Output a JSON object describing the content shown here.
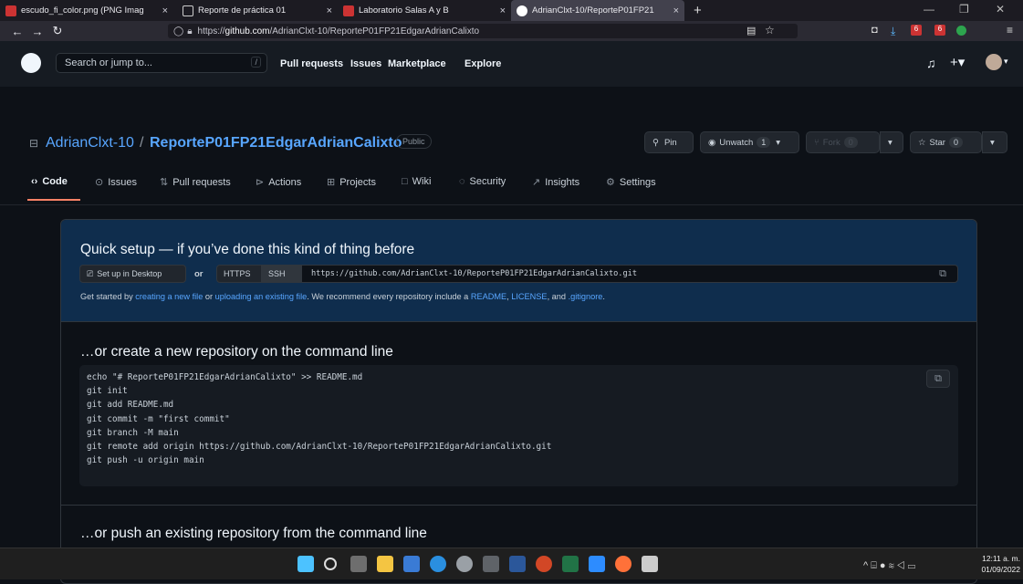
{
  "browser": {
    "tabs": [
      {
        "title": "escudo_fi_color.png (PNG Imag",
        "close": "×"
      },
      {
        "title": "Reporte de práctica 01",
        "close": "×"
      },
      {
        "title": "Laboratorio Salas A y B",
        "close": "×"
      },
      {
        "title": "AdrianClxt-10/ReporteP01FP21",
        "close": "×"
      }
    ],
    "new_tab": "+",
    "url_prefix": "https://",
    "url_host": "github.com",
    "url_path": "/AdrianClxt-10/ReporteP01FP21EdgarAdrianCalixto",
    "ext_badge_1": "6",
    "ext_badge_2": "6"
  },
  "github": {
    "search_placeholder": "Search or jump to...",
    "search_key": "/",
    "nav": [
      "Pull requests",
      "Issues",
      "Marketplace",
      "Explore"
    ]
  },
  "repo": {
    "owner": "AdrianClxt-10",
    "sep": "/",
    "name": "ReporteP01FP21EdgarAdrianCalixto",
    "visibility": "Public",
    "pin": "Pin",
    "unwatch": "Unwatch",
    "unwatch_count": "1",
    "fork": "Fork",
    "fork_count": "0",
    "star": "Star",
    "star_count": "0",
    "tabs": [
      "Code",
      "Issues",
      "Pull requests",
      "Actions",
      "Projects",
      "Wiki",
      "Security",
      "Insights",
      "Settings"
    ]
  },
  "quick_setup": {
    "title": "Quick setup — if you’ve done this kind of thing before",
    "desktop_btn": "Set up in Desktop",
    "or": "or",
    "https": "HTTPS",
    "ssh": "SSH",
    "clone_url": "https://github.com/AdrianClxt-10/ReporteP01FP21EdgarAdrianCalixto.git",
    "note_pre": "Get started by ",
    "link_new": "creating a new file",
    "note_or": " or ",
    "link_upload": "uploading an existing file",
    "note_mid": ". We recommend every repository include a ",
    "link_readme": "README",
    "comma1": ", ",
    "link_license": "LICENSE",
    "note_and": ", and ",
    "link_gitignore": ".gitignore",
    "note_end": "."
  },
  "cmdline": {
    "title": "…or create a new repository on the command line",
    "code": "echo \"# ReporteP01FP21EdgarAdrianCalixto\" >> README.md\ngit init\ngit add README.md\ngit commit -m \"first commit\"\ngit branch -M main\ngit remote add origin https://github.com/AdrianClxt-10/ReporteP01FP21EdgarAdrianCalixto.git\ngit push -u origin main"
  },
  "push_existing": {
    "title": "…or push an existing repository from the command line"
  },
  "taskbar": {
    "time": "12:11 a. m.",
    "date": "01/09/2022"
  },
  "colors": {
    "accent": "#58a6ff",
    "quick_bg": "#0f2d4d",
    "page_bg": "#0d1117",
    "underline": "#f78166"
  }
}
